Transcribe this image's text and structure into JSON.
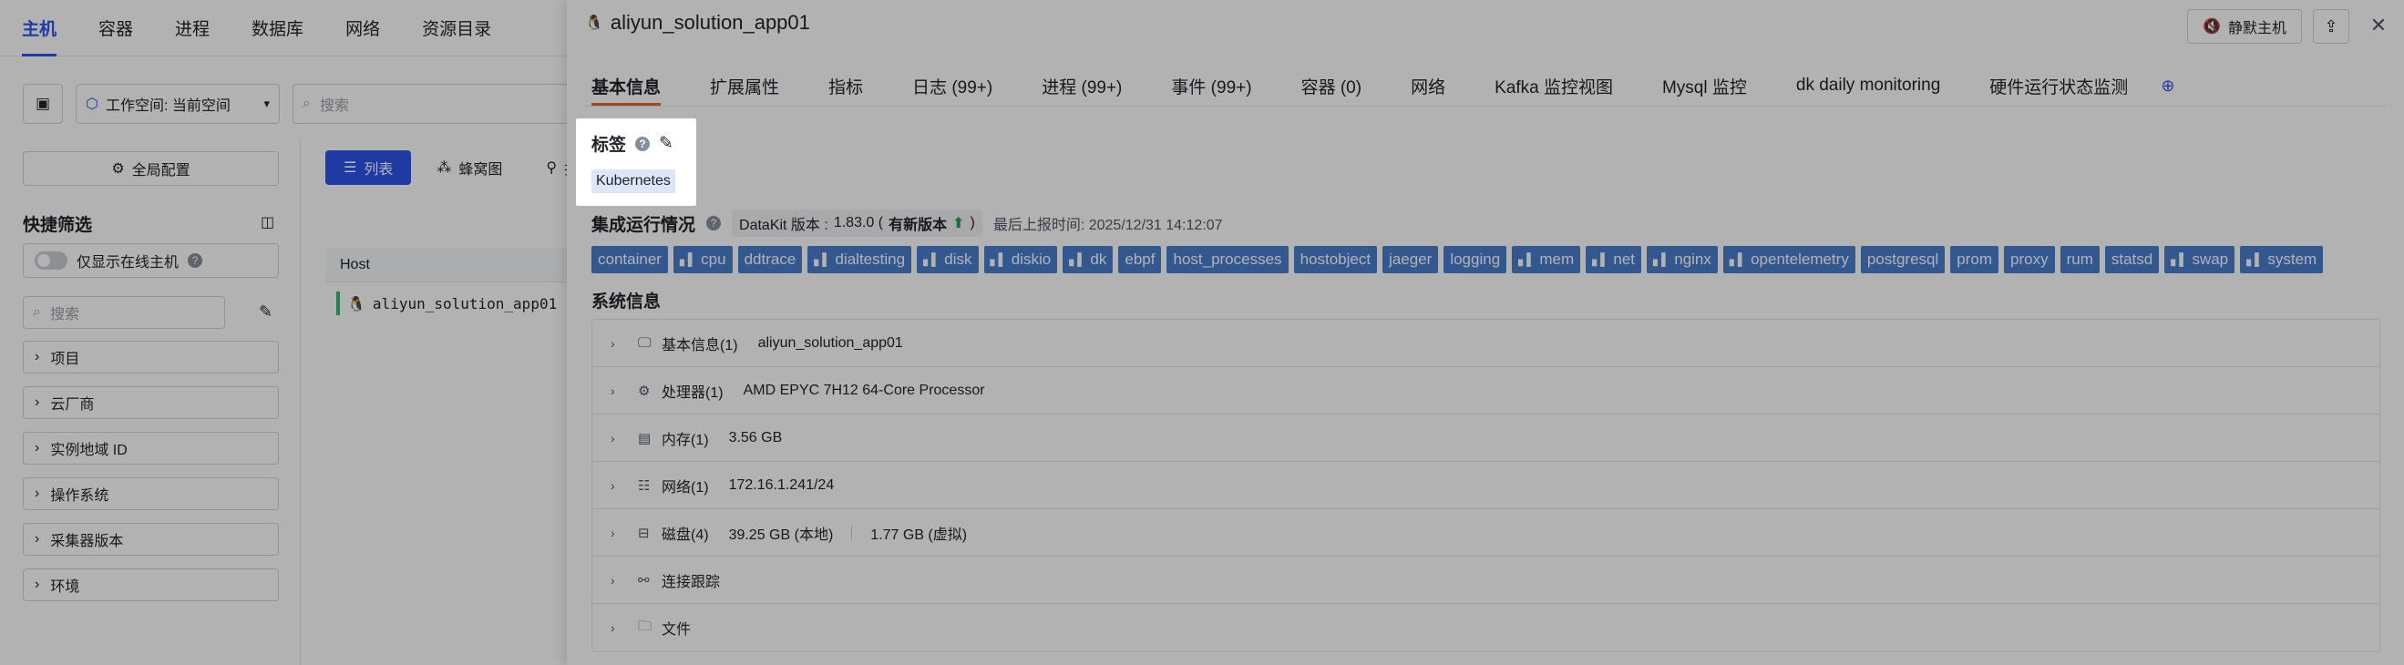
{
  "topnav": [
    "主机",
    "容器",
    "进程",
    "数据库",
    "网络",
    "资源目录"
  ],
  "workspace": {
    "label": "工作空间: 当前空间",
    "search_placeholder": "搜索"
  },
  "left": {
    "global_config": "全局配置",
    "quick_filter": "快捷筛选",
    "online_only": "仅显示在线主机",
    "search_placeholder": "搜索",
    "filters": [
      "项目",
      "云厂商",
      "实例地域 ID",
      "操作系统",
      "采集器版本",
      "环境"
    ]
  },
  "view_tabs": [
    "列表",
    "蜂窝图",
    "拓"
  ],
  "host_table": {
    "header": "Host",
    "row": "aliyun_solution_app01"
  },
  "drawer": {
    "title": "aliyun_solution_app01",
    "mute_label": "静默主机",
    "tabs": [
      "基本信息",
      "扩展属性",
      "指标",
      "日志 (99+)",
      "进程 (99+)",
      "事件 (99+)",
      "容器 (0)",
      "网络",
      "Kafka 监控视图",
      "Mysql 监控",
      "dk daily monitoring",
      "硬件运行状态监测"
    ],
    "tags_label": "标签",
    "tags": [
      "Kubernetes"
    ],
    "integration": {
      "title": "集成运行情况",
      "version_prefix": "DataKit 版本 :",
      "version": "1.83.0 (",
      "new_version": "有新版本",
      "version_suffix": ")",
      "report_time": "最后上报时间: 2025/12/31 14:12:07"
    },
    "chips": [
      {
        "label": "container",
        "icon": false
      },
      {
        "label": "cpu",
        "icon": true
      },
      {
        "label": "ddtrace",
        "icon": false
      },
      {
        "label": "dialtesting",
        "icon": true
      },
      {
        "label": "disk",
        "icon": true
      },
      {
        "label": "diskio",
        "icon": true
      },
      {
        "label": "dk",
        "icon": true
      },
      {
        "label": "ebpf",
        "icon": false
      },
      {
        "label": "host_processes",
        "icon": false
      },
      {
        "label": "hostobject",
        "icon": false
      },
      {
        "label": "jaeger",
        "icon": false
      },
      {
        "label": "logging",
        "icon": false
      },
      {
        "label": "mem",
        "icon": true
      },
      {
        "label": "net",
        "icon": true
      },
      {
        "label": "nginx",
        "icon": true
      },
      {
        "label": "opentelemetry",
        "icon": true
      },
      {
        "label": "postgresql",
        "icon": false
      },
      {
        "label": "prom",
        "icon": false
      },
      {
        "label": "proxy",
        "icon": false
      },
      {
        "label": "rum",
        "icon": false
      },
      {
        "label": "statsd",
        "icon": false
      },
      {
        "label": "swap",
        "icon": true
      },
      {
        "label": "system",
        "icon": true
      }
    ],
    "sys_title": "系统信息",
    "sys_rows": [
      {
        "label": "基本信息(1)",
        "value": "aliyun_solution_app01",
        "value2": "",
        "icon": "basic-info-icon",
        "glyph": "🖵"
      },
      {
        "label": "处理器(1)",
        "value": "AMD EPYC 7H12 64-Core Processor",
        "value2": "",
        "icon": "cpu-icon",
        "glyph": "⚙"
      },
      {
        "label": "内存(1)",
        "value": "3.56 GB",
        "value2": "",
        "icon": "memory-icon",
        "glyph": "▤"
      },
      {
        "label": "网络(1)",
        "value": "172.16.1.241/24",
        "value2": "",
        "icon": "network-icon",
        "glyph": "☷"
      },
      {
        "label": "磁盘(4)",
        "value": "39.25 GB (本地)",
        "value2": "1.77 GB (虚拟)",
        "icon": "disk-icon",
        "glyph": "⊟"
      },
      {
        "label": "连接跟踪",
        "value": "",
        "value2": "",
        "icon": "connection-icon",
        "glyph": "⚯"
      },
      {
        "label": "文件",
        "value": "",
        "value2": "",
        "icon": "file-icon",
        "glyph": "🗀"
      }
    ]
  },
  "colors": {
    "accent": "#2f54eb",
    "tab_underline": "#e8632b",
    "chip_bg": "#4a7fcf",
    "tag_bg": "#dde7fb",
    "online": "#2bbf6a"
  }
}
